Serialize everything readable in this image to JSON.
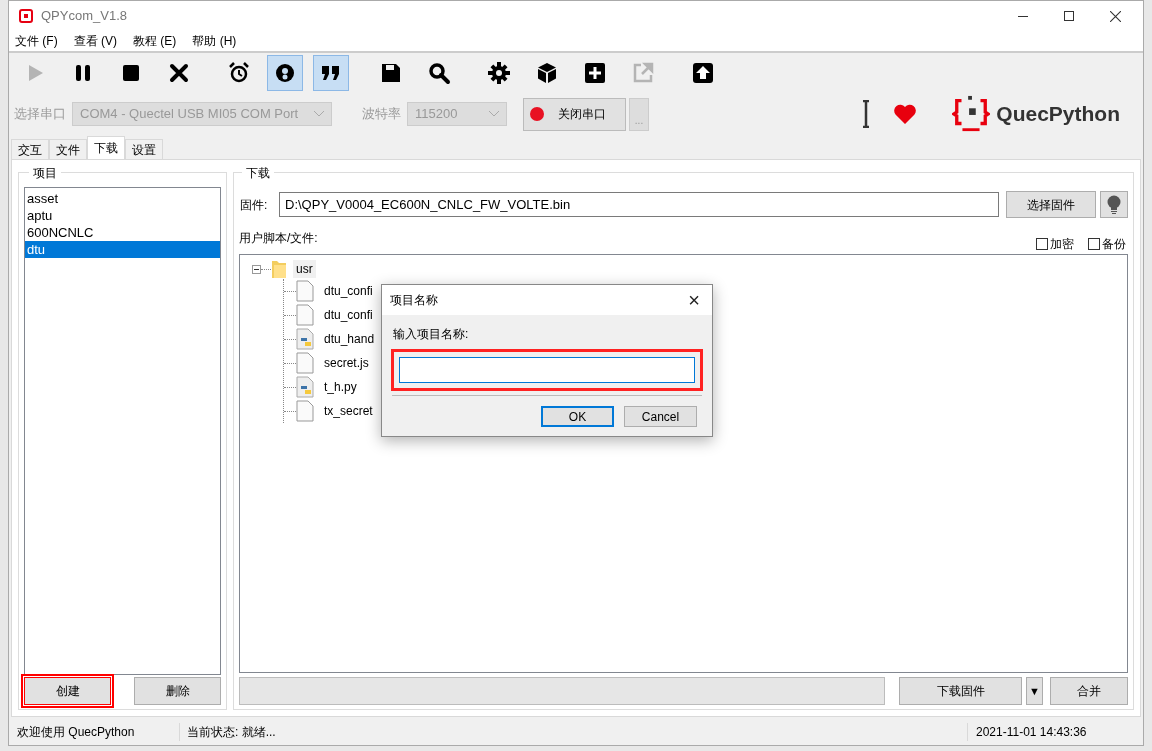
{
  "window": {
    "title": "QPYcom_V1.8"
  },
  "menu": [
    "文件 (F)",
    "查看 (V)",
    "教程 (E)",
    "帮助 (H)"
  ],
  "toolbar": [
    {
      "kind": "play",
      "selected": false,
      "disabled": true
    },
    {
      "kind": "pause",
      "selected": false,
      "disabled": false
    },
    {
      "kind": "stop",
      "selected": false,
      "disabled": false
    },
    {
      "kind": "close",
      "selected": false,
      "disabled": false
    },
    {
      "kind": "alarm",
      "selected": false,
      "disabled": false
    },
    {
      "kind": "ring",
      "selected": true,
      "disabled": false
    },
    {
      "kind": "quote",
      "selected": true,
      "disabled": false
    },
    {
      "kind": "save",
      "selected": false,
      "disabled": false
    },
    {
      "kind": "search",
      "selected": false,
      "disabled": false
    },
    {
      "kind": "gear",
      "selected": false,
      "disabled": false
    },
    {
      "kind": "cube",
      "selected": false,
      "disabled": false
    },
    {
      "kind": "plus",
      "selected": false,
      "disabled": false
    },
    {
      "kind": "export",
      "selected": false,
      "disabled": true
    },
    {
      "kind": "upload",
      "selected": false,
      "disabled": false
    }
  ],
  "port": {
    "label": "选择串口",
    "value": "COM4 - Quectel USB MI05 COM Port",
    "baud_label": "波特率",
    "baud": "115200",
    "open_button": "关闭串口",
    "more_button": "..."
  },
  "brand": {
    "name": "QuecPython"
  },
  "tabs": [
    {
      "label": "交互",
      "selected": false
    },
    {
      "label": "文件",
      "selected": false
    },
    {
      "label": "下载",
      "selected": true
    },
    {
      "label": "设置",
      "selected": false
    }
  ],
  "projects": {
    "title": "项目",
    "items": [
      {
        "label": "asset",
        "selected": false
      },
      {
        "label": "aptu",
        "selected": false
      },
      {
        "label": "600NCNLC",
        "selected": false
      },
      {
        "label": "dtu",
        "selected": true
      }
    ],
    "buttons": [
      {
        "label": "创建",
        "highlighted": true
      },
      {
        "label": "删除",
        "highlighted": false
      }
    ]
  },
  "download": {
    "title": "下载",
    "firmware_label": "固件:",
    "firmware_path": "D:\\QPY_V0004_EC600N_CNLC_FW_VOLTE.bin",
    "choose_button": "选择固件",
    "files_label": "用户脚本/文件:",
    "options": [
      {
        "label": "加密",
        "checked": false
      },
      {
        "label": "备份",
        "checked": false
      }
    ],
    "tree": {
      "label": "usr",
      "expanded": true,
      "children": [
        {
          "label": "dtu_confi",
          "kind": "file"
        },
        {
          "label": "dtu_confi",
          "kind": "file"
        },
        {
          "label": "dtu_hand",
          "kind": "python"
        },
        {
          "label": "secret.js",
          "kind": "file"
        },
        {
          "label": "t_h.py",
          "kind": "python"
        },
        {
          "label": "tx_secret",
          "kind": "file"
        }
      ]
    },
    "progress": {
      "level": 0
    },
    "download_button": "下载固件",
    "dropdown_button": "▼",
    "merge_button": "合并"
  },
  "dialog": {
    "title": "项目名称",
    "close": "×",
    "prompt": "输入项目名称:",
    "highlighted": true,
    "ok": "OK",
    "cancel": "Cancel"
  },
  "status_bar": {
    "welcome": "欢迎使用 QuecPython",
    "state": "当前状态: 就绪...",
    "datetime": "2021-11-01 14:43:36"
  }
}
